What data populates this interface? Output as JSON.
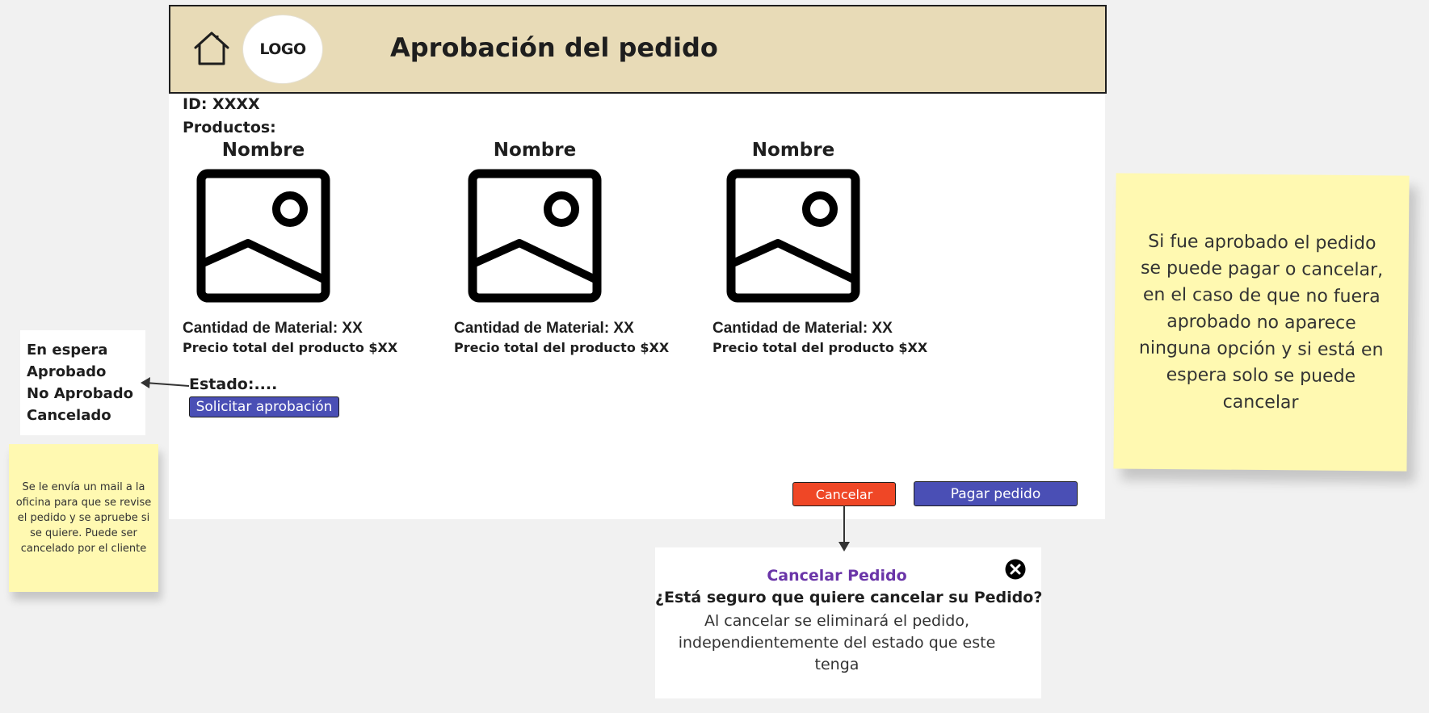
{
  "header": {
    "logo_text": "LOGO",
    "title": "Aprobación del pedido",
    "home_icon": "home-icon"
  },
  "order": {
    "id_label": "ID: XXXX",
    "products_label": "Productos:",
    "status_label": "Estado:....",
    "request_approval_label": "Solicitar aprobación"
  },
  "products": [
    {
      "name": "Nombre",
      "quantity": "Cantidad de Material: XX",
      "price": "Precio total del producto $XX"
    },
    {
      "name": "Nombre",
      "quantity": "Cantidad de Material: XX",
      "price": "Precio total del producto $XX"
    },
    {
      "name": "Nombre",
      "quantity": "Cantidad de Material: XX",
      "price": "Precio total del producto $XX"
    }
  ],
  "actions": {
    "cancel_label": "Cancelar",
    "pay_label": "Pagar pedido"
  },
  "status_options": [
    "En espera",
    "Aprobado",
    "No Aprobado",
    "Cancelado"
  ],
  "notes": {
    "left": "Se le envía un mail a la oficina para que se revise el pedido y se apruebe si se quiere. Puede ser cancelado por el cliente",
    "right": "Si fue aprobado el pedido se puede pagar o cancelar, en el caso de que no fuera aprobado no aparece ninguna opción y si está en espera solo se puede cancelar"
  },
  "cancel_dialog": {
    "title": "Cancelar Pedido",
    "question": "¿Está seguro que quiere cancelar su Pedido?",
    "message": "Al cancelar se eliminará el pedido, independientemente del estado que este tenga"
  },
  "colors": {
    "header_bg": "#e8dbb7",
    "primary_button": "#4a4fb5",
    "danger_button": "#ef4726",
    "sticky_note": "#fff9b1",
    "dialog_title": "#6a35a8"
  }
}
